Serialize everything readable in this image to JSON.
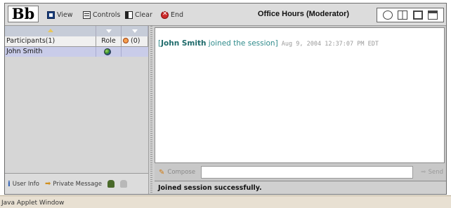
{
  "toolbar": {
    "logo": "Bb",
    "buttons": [
      {
        "label": "View",
        "icon": "view-icon"
      },
      {
        "label": "Controls",
        "icon": "controls-icon"
      },
      {
        "label": "Clear",
        "icon": "clear-icon"
      },
      {
        "label": "End",
        "icon": "end-icon"
      }
    ],
    "title": "Office Hours (Moderator)",
    "layout_icons": [
      "layout-circle-icon",
      "layout-columns-icon",
      "layout-box-icon",
      "layout-window-icon"
    ]
  },
  "participants": {
    "columns": [
      "Participants(1)",
      "Role",
      "(0)"
    ],
    "rows": [
      {
        "name": "John Smith",
        "role_icon": "globe-icon"
      }
    ]
  },
  "left_footer": {
    "user_info_label": "User Info",
    "private_message_label": "Private Message"
  },
  "chat": {
    "messages": [
      {
        "open": "[",
        "name": "John Smith",
        "text": " joined the session]",
        "timestamp": " Aug 9, 2004 12:37:07 PM EDT"
      }
    ]
  },
  "compose": {
    "compose_label": "Compose",
    "input_value": "",
    "send_label": "Send"
  },
  "status": {
    "text": "Joined session successfully."
  },
  "window": {
    "applet_label": "Java Applet Window"
  }
}
